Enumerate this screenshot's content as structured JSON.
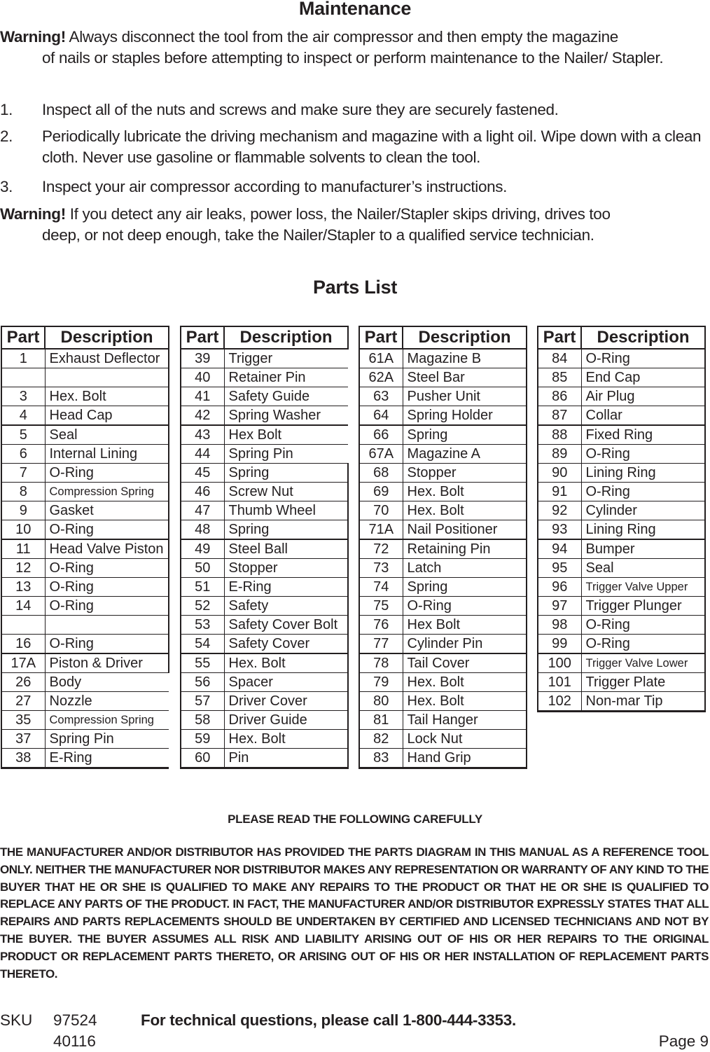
{
  "maintenance": {
    "title": "Maintenance",
    "warning1_lead": "Warning!",
    "warning1_first": "Always disconnect the tool from the air compressor and then empty the magazine",
    "warning1_rest": "of nails or staples before attempting to inspect or perform maintenance to the Nailer/ Stapler.",
    "items": [
      {
        "num": "1.",
        "text": "Inspect all of the nuts and screws and make sure they are securely fastened."
      },
      {
        "num": "2.",
        "text": "Periodically lubricate the driving mechanism and magazine with a light oil.  Wipe down with a clean cloth.  Never use gasoline or flammable solvents to clean the tool."
      },
      {
        "num": "3.",
        "text": "Inspect your air compressor according to manufacturer’s instructions."
      }
    ],
    "warning2_lead": "Warning!",
    "warning2_first": "If you detect any air leaks, power loss, the Nailer/Stapler skips driving, drives too",
    "warning2_rest": "deep, or not deep enough, take the Nailer/Stapler to a qualified service technician."
  },
  "parts_list": {
    "title": "Parts List",
    "header_part": "Part",
    "header_description": "Description",
    "tables": [
      [
        [
          "1",
          "Exhaust Deflector"
        ],
        [
          "",
          ""
        ],
        [
          "3",
          "Hex. Bolt"
        ],
        [
          "4",
          "Head Cap"
        ],
        [
          "5",
          "Seal"
        ],
        [
          "6",
          "Internal Lining"
        ],
        [
          "7",
          "O-Ring"
        ],
        [
          "8",
          "Compression Spring"
        ],
        [
          "9",
          "Gasket"
        ],
        [
          "10",
          "O-Ring"
        ],
        [
          "11",
          "Head Valve Piston"
        ],
        [
          "12",
          "O-Ring"
        ],
        [
          "13",
          "O-Ring"
        ],
        [
          "14",
          "O-Ring"
        ],
        [
          "",
          ""
        ],
        [
          "16",
          "O-Ring"
        ],
        [
          "17A",
          "Piston & Driver"
        ],
        [
          "26",
          "Body"
        ],
        [
          "27",
          "Nozzle"
        ],
        [
          "35",
          "Compression Spring"
        ],
        [
          "37",
          "Spring Pin"
        ],
        [
          "38",
          "E-Ring"
        ]
      ],
      [
        [
          "39",
          "Trigger"
        ],
        [
          "40",
          "Retainer Pin"
        ],
        [
          "41",
          "Safety Guide"
        ],
        [
          "42",
          "Spring Washer"
        ],
        [
          "43",
          "Hex Bolt"
        ],
        [
          "44",
          "Spring Pin"
        ],
        [
          "45",
          "Spring"
        ],
        [
          "46",
          "Screw Nut"
        ],
        [
          "47",
          "Thumb Wheel"
        ],
        [
          "48",
          "Spring"
        ],
        [
          "49",
          "Steel Ball"
        ],
        [
          "50",
          "Stopper"
        ],
        [
          "51",
          "E-Ring"
        ],
        [
          "52",
          "Safety"
        ],
        [
          "53",
          "Safety Cover Bolt"
        ],
        [
          "54",
          "Safety Cover"
        ],
        [
          "55",
          "Hex. Bolt"
        ],
        [
          "56",
          "Spacer"
        ],
        [
          "57",
          "Driver Cover"
        ],
        [
          "58",
          "Driver Guide"
        ],
        [
          "59",
          "Hex. Bolt"
        ],
        [
          "60",
          "Pin"
        ]
      ],
      [
        [
          "61A",
          "Magazine B"
        ],
        [
          "62A",
          "Steel Bar"
        ],
        [
          "63",
          "Pusher Unit"
        ],
        [
          "64",
          "Spring Holder"
        ],
        [
          "66",
          "Spring"
        ],
        [
          "67A",
          "Magazine A"
        ],
        [
          "68",
          "Stopper"
        ],
        [
          "69",
          "Hex. Bolt"
        ],
        [
          "70",
          "Hex. Bolt"
        ],
        [
          "71A",
          "Nail Positioner"
        ],
        [
          "72",
          "Retaining Pin"
        ],
        [
          "73",
          "Latch"
        ],
        [
          "74",
          "Spring"
        ],
        [
          "75",
          "O-Ring"
        ],
        [
          "76",
          "Hex Bolt"
        ],
        [
          "77",
          "Cylinder Pin"
        ],
        [
          "78",
          "Tail Cover"
        ],
        [
          "79",
          "Hex. Bolt"
        ],
        [
          "80",
          "Hex. Bolt"
        ],
        [
          "81",
          "Tail Hanger"
        ],
        [
          "82",
          "Lock Nut"
        ],
        [
          "83",
          "Hand Grip"
        ]
      ],
      [
        [
          "84",
          "O-Ring"
        ],
        [
          "85",
          "End Cap"
        ],
        [
          "86",
          "Air Plug"
        ],
        [
          "87",
          "Collar"
        ],
        [
          "88",
          "Fixed Ring"
        ],
        [
          "89",
          "O-Ring"
        ],
        [
          "90",
          "Lining Ring"
        ],
        [
          "91",
          "O-Ring"
        ],
        [
          "92",
          "Cylinder"
        ],
        [
          "93",
          "Lining Ring"
        ],
        [
          "94",
          "Bumper"
        ],
        [
          "95",
          "Seal"
        ],
        [
          "96",
          "Trigger Valve Upper"
        ],
        [
          "97",
          "Trigger Plunger"
        ],
        [
          "98",
          "O-Ring"
        ],
        [
          "99",
          "O-Ring"
        ],
        [
          "100",
          "Trigger Valve Lower"
        ],
        [
          "101",
          "Trigger Plate"
        ],
        [
          "102",
          "Non-mar Tip"
        ]
      ]
    ]
  },
  "notice": {
    "title": "PLEASE READ THE FOLLOWING CAREFULLY",
    "body": "THE MANUFACTURER AND/OR DISTRIBUTOR HAS PROVIDED THE PARTS DIAGRAM IN THIS MANUAL AS A REFERENCE TOOL ONLY.  NEITHER THE MANUFACTURER NOR DISTRIBUTOR MAKES ANY REPRESENTATION OR WARRANTY OF ANY KIND TO THE BUYER THAT HE OR SHE IS QUALIFIED TO MAKE ANY REPAIRS TO THE PRODUCT OR THAT HE OR SHE IS QUALIFIED TO REPLACE ANY PARTS OF THE PRODUCT.  IN FACT, THE MANUFACTURER AND/OR DISTRIBUTOR EXPRESSLY STATES THAT ALL REPAIRS AND PARTS REPLACEMENTS SHOULD BE UNDERTAKEN BY CERTIFIED AND LICENSED TECHNICIANS AND NOT BY THE BUYER. THE BUYER ASSUMES ALL RISK AND LIABILITY ARISING OUT OF HIS OR HER REPAIRS TO THE ORIGINAL PRODUCT OR REPLACEMENT PARTS THERETO, OR ARISING OUT OF HIS OR HER INSTALLATION OF REPLACEMENT PARTS THERETO."
  },
  "footer": {
    "sku_label": "SKU",
    "sku_1": "97524",
    "sku_2": "40116",
    "phone_text": "For technical questions, please call 1-800-444-3353.",
    "page": "Page 9"
  }
}
